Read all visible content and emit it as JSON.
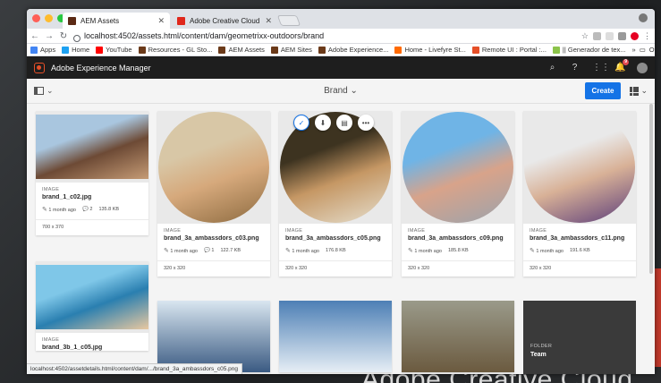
{
  "browser": {
    "tabs": [
      {
        "title": "AEM Assets",
        "favicon_color": "#5b2a14",
        "active": true
      },
      {
        "title": "Adobe Creative Cloud",
        "favicon_color": "#e0271b",
        "active": false
      }
    ],
    "url": "localhost:4502/assets.html/content/dam/geometrixx-outdoors/brand",
    "bookmarks": [
      {
        "label": "Apps",
        "color": "#4285f4"
      },
      {
        "label": "Home",
        "color": "#1da1f2"
      },
      {
        "label": "YouTube",
        "color": "#ff0000"
      },
      {
        "label": "Resources - GL Sto...",
        "color": "#6b3a1a"
      },
      {
        "label": "AEM Assets",
        "color": "#6b3a1a"
      },
      {
        "label": "AEM Sites",
        "color": "#6b3a1a"
      },
      {
        "label": "Adobe Experience...",
        "color": "#6b3a1a"
      },
      {
        "label": "Home - Livefyre St...",
        "color": "#ff6a00"
      },
      {
        "label": "Remote UI : Portal :...",
        "color": "#e54f28"
      },
      {
        "label": "|| Generador de tex...",
        "color": "#8bc34a"
      }
    ],
    "more_bookmarks": "»",
    "other_bookmarks": "Other Bookmarks",
    "status_url": "localhost:4502/assetdetails.html/content/dam/.../brand_3a_ambassdors_c05.png"
  },
  "aem": {
    "product_name": "Adobe Experience Manager",
    "notification_count": "9",
    "breadcrumb": "Brand",
    "create_label": "Create",
    "chevron": "⌄"
  },
  "assets": [
    {
      "kind": "IMAGE",
      "name": "brand_1_c02.jpg",
      "modified": "1 month ago",
      "comments": "2",
      "size": "135.8 KB",
      "dims": "700 x 370",
      "palette": [
        "#a9c6df",
        "#6d4a35",
        "#c59b75"
      ]
    },
    {
      "kind": "IMAGE",
      "name": "brand_3a_ambassdors_c03.png",
      "modified": "1 month ago",
      "comments": "1",
      "size": "122.7 KB",
      "dims": "320 x 320",
      "palette": [
        "#d8c7a6",
        "#d6a97c",
        "#8c6a3f"
      ]
    },
    {
      "kind": "IMAGE",
      "name": "brand_3a_ambassdors_c05.png",
      "modified": "1 month ago",
      "comments": "",
      "size": "176.8 KB",
      "dims": "320 x 320",
      "palette": [
        "#3d3320",
        "#c59764",
        "#e6e0d0"
      ]
    },
    {
      "kind": "IMAGE",
      "name": "brand_3a_ambassdors_c09.png",
      "modified": "1 month ago",
      "comments": "",
      "size": "185.8 KB",
      "dims": "320 x 320",
      "palette": [
        "#6fb4e6",
        "#d8a38a",
        "#9aa3ad"
      ]
    },
    {
      "kind": "IMAGE",
      "name": "brand_3a_ambassdors_c11.png",
      "modified": "1 month ago",
      "comments": "",
      "size": "191.6 KB",
      "dims": "320 x 320",
      "palette": [
        "#e9e9e9",
        "#d8b197",
        "#5b3d7a"
      ]
    },
    {
      "kind": "IMAGE",
      "name": "brand_3b_1_c05.jpg",
      "palette": [
        "#7fc7e8",
        "#2a7fb0",
        "#e8c8a0"
      ]
    }
  ],
  "second_row_colors": [
    [
      "#d9e6f0",
      "#3a5a82"
    ],
    [
      "#4d7fb5",
      "#e6eef5"
    ],
    [
      "#9a9a8a",
      "#6b5a3f"
    ]
  ],
  "folder": {
    "kind": "FOLDER",
    "title": "Team"
  },
  "desktop_text": "Adobe Creative Cloud"
}
